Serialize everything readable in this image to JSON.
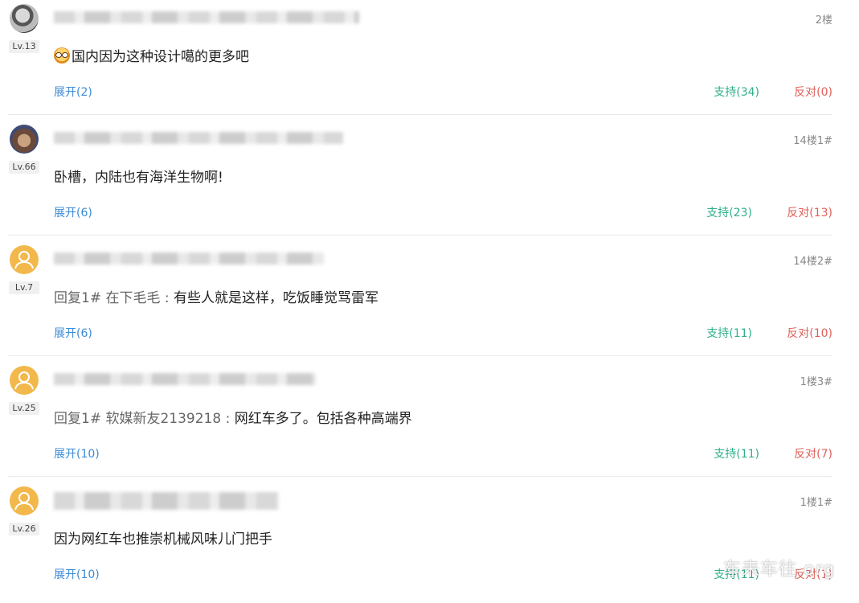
{
  "comments": [
    {
      "level": "Lv.13",
      "floor": "2楼",
      "content": "国内因为这种设计噶的更多吧",
      "expand": "展开(2)",
      "support": "支持(34)",
      "oppose": "反对(0)"
    },
    {
      "level": "Lv.66",
      "floor": "14楼1#",
      "content": "卧槽，内陆也有海洋生物啊!",
      "expand": "展开(6)",
      "support": "支持(23)",
      "oppose": "反对(13)"
    },
    {
      "level": "Lv.7",
      "floor": "14楼2#",
      "reply_prefix": "回复1# 在下毛毛 : ",
      "content": "有些人就是这样，吃饭睡觉骂雷军",
      "expand": "展开(6)",
      "support": "支持(11)",
      "oppose": "反对(10)"
    },
    {
      "level": "Lv.25",
      "floor": "1楼3#",
      "reply_prefix": "回复1# 软媒新友2139218 : ",
      "content": "网红车多了。包括各种高端界",
      "expand": "展开(10)",
      "support": "支持(11)",
      "oppose": "反对(7)"
    },
    {
      "level": "Lv.26",
      "floor": "1楼1#",
      "content": "因为网红车也推崇机械风味儿门把手",
      "expand": "展开(10)",
      "support": "支持(11)",
      "oppose": "反对(1)"
    }
  ],
  "watermark": "车来车往.org",
  "icons": {
    "emoji": "laughing-emoji-icon",
    "avatar_default": "user-silhouette-icon"
  },
  "colors": {
    "expand": "#3b8bd6",
    "support": "#2fb08a",
    "oppose": "#e0605a",
    "avatar_default": "#f2b84b"
  }
}
